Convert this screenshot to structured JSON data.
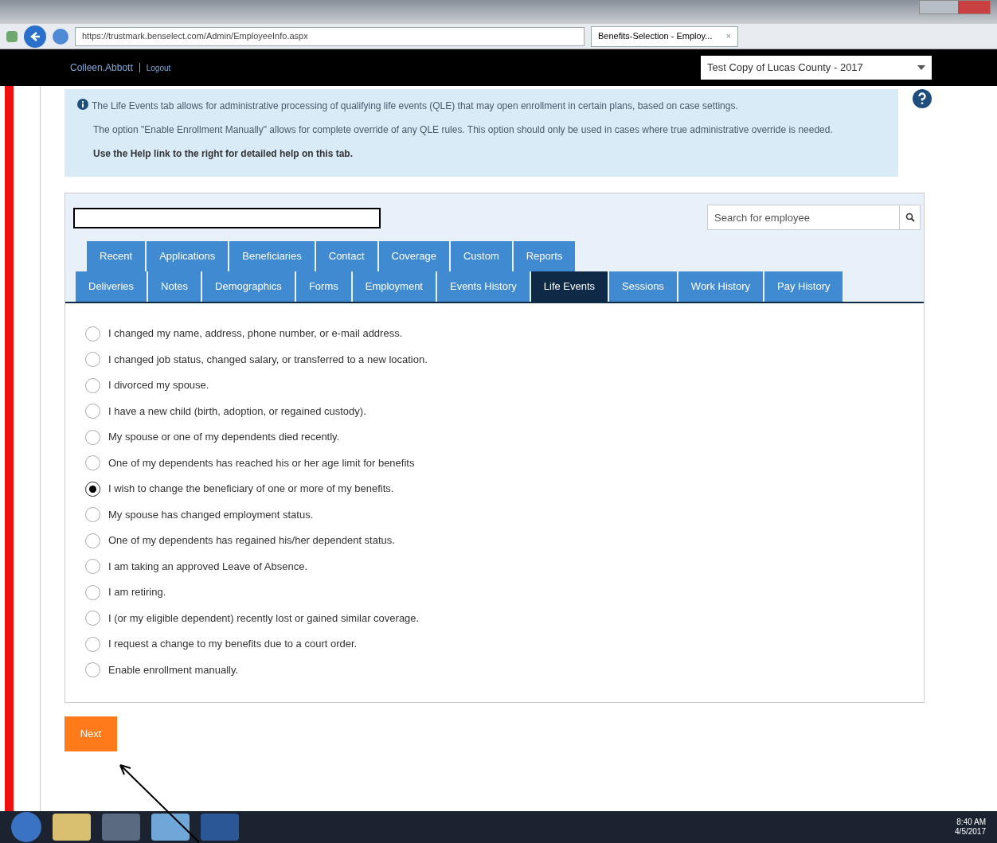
{
  "browser": {
    "url": "https://trustmark.benselect.com/Admin/EmployeeInfo.aspx",
    "tab_title": "Benefits-Selection - Employ...",
    "tab_close": "×"
  },
  "header": {
    "user": "Colleen.Abbott",
    "logout": "Logout",
    "case_select": "Test Copy of Lucas County - 2017"
  },
  "info": {
    "lines": [
      "The Life Events tab allows for administrative processing of qualifying life events (QLE) that may open enrollment in certain plans, based on case settings.",
      "The option \"Enable Enrollment Manually\" allows for complete override of any QLE rules. This option should only be used in cases where true administrative override is needed."
    ],
    "help_note": "Use the Help link to the right for detailed help on this tab."
  },
  "search": {
    "placeholder": "Search for employee"
  },
  "tabs_row1": [
    {
      "label": "Recent",
      "selected": false
    },
    {
      "label": "Applications",
      "selected": false
    },
    {
      "label": "Beneficiaries",
      "selected": false
    },
    {
      "label": "Contact",
      "selected": false
    },
    {
      "label": "Coverage",
      "selected": false
    },
    {
      "label": "Custom",
      "selected": false
    },
    {
      "label": "Reports",
      "selected": false
    }
  ],
  "tabs_row2": [
    {
      "label": "Deliveries",
      "selected": false
    },
    {
      "label": "Notes",
      "selected": false
    },
    {
      "label": "Demographics",
      "selected": false
    },
    {
      "label": "Forms",
      "selected": false
    },
    {
      "label": "Employment",
      "selected": false
    },
    {
      "label": "Events History",
      "selected": false
    },
    {
      "label": "Life Events",
      "selected": true
    },
    {
      "label": "Sessions",
      "selected": false
    },
    {
      "label": "Work History",
      "selected": false
    },
    {
      "label": "Pay History",
      "selected": false
    }
  ],
  "options": [
    {
      "label": "I changed my name, address, phone number, or e-mail address.",
      "selected": false
    },
    {
      "label": "I changed job status, changed salary, or transferred to a new location.",
      "selected": false
    },
    {
      "label": "I divorced my spouse.",
      "selected": false
    },
    {
      "label": "I have a new child (birth, adoption, or regained custody).",
      "selected": false
    },
    {
      "label": "My spouse or one of my dependents died recently.",
      "selected": false
    },
    {
      "label": "One of my dependents has reached his or her age limit for benefits",
      "selected": false
    },
    {
      "label": "I wish to change the beneficiary of one or more of my benefits.",
      "selected": true
    },
    {
      "label": "My spouse has changed employment status.",
      "selected": false
    },
    {
      "label": "One of my dependents has regained his/her dependent status.",
      "selected": false
    },
    {
      "label": "I am taking an approved Leave of Absence.",
      "selected": false
    },
    {
      "label": "I am retiring.",
      "selected": false
    },
    {
      "label": "I (or my eligible dependent) recently lost or gained similar coverage.",
      "selected": false
    },
    {
      "label": "I request a change to my benefits due to a court order.",
      "selected": false
    },
    {
      "label": "Enable enrollment manually.",
      "selected": false
    }
  ],
  "next_button": "Next",
  "taskbar": {
    "time": "8:40 AM",
    "date": "4/5/2017"
  }
}
